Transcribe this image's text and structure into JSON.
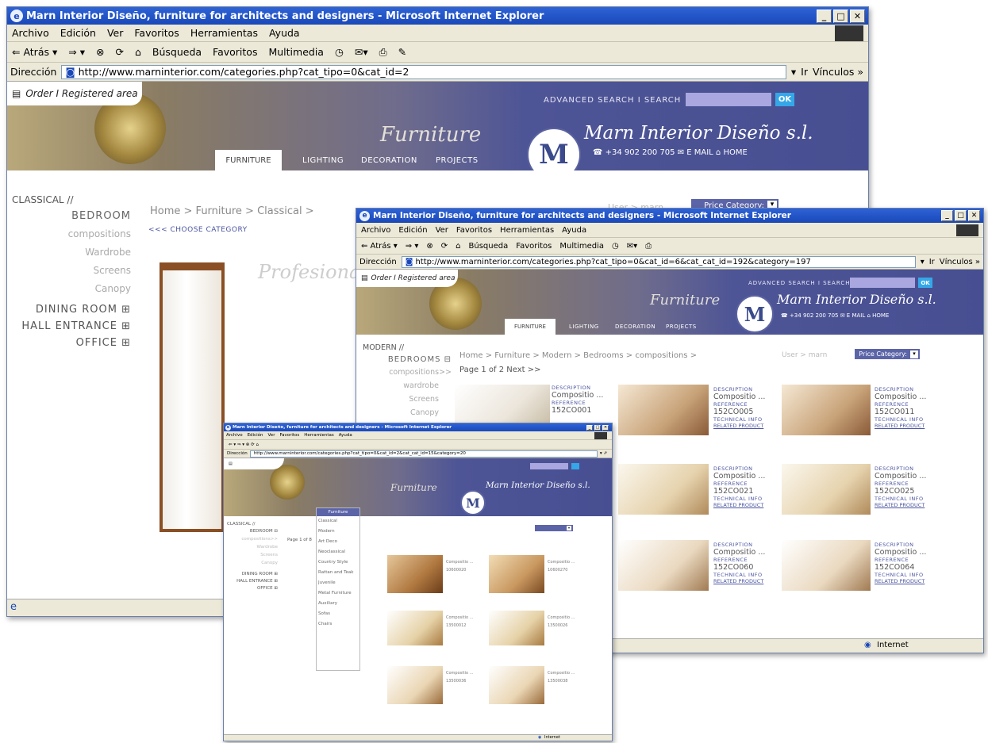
{
  "windows": {
    "back": {
      "title": "Marn Interior Diseño, furniture for architects and designers - Microsoft Internet Explorer",
      "menu": [
        "Archivo",
        "Edición",
        "Ver",
        "Favoritos",
        "Herramientas",
        "Ayuda"
      ],
      "toolbar": [
        "⇐ Atrás ▾",
        "⇒ ▾",
        "Búsqueda",
        "Favoritos",
        "Multimedia"
      ],
      "address_label": "Dirección",
      "url": "http://www.marninterior.com/categories.php?cat_tipo=0&cat_id=2",
      "go": "Ir",
      "links": "Vínculos »",
      "order": "Order I Registered area",
      "search_label": "ADVANCED SEARCH  I  SEARCH",
      "ok": "OK",
      "brand": "Marn Interior Diseño s.l.",
      "contact": "☎ +34 902 200 705   ✉ E MAIL   ⌂ HOME",
      "furniture_word": "Furniture",
      "nav": [
        "FURNITURE",
        "LIGHTING",
        "DECORATION",
        "PROJECTS"
      ],
      "logo": "M",
      "side_title": "CLASSICAL //",
      "side_items": [
        "BEDROOM",
        "compositions",
        "Wardrobe",
        "Screens",
        "Canopy"
      ],
      "side_groups": [
        "DINING ROOM ⊞",
        "HALL ENTRANCE ⊞",
        "OFFICE ⊞"
      ],
      "crumb": "Home > Furniture > Classical >",
      "choose": "<<< CHOOSE CATEGORY",
      "script_word": "Profesionale",
      "user": "User > marn",
      "price_category": "Price Category:"
    },
    "mid": {
      "title": "Marn Interior Diseño, furniture for architects and designers - Microsoft Internet Explorer",
      "menu": [
        "Archivo",
        "Edición",
        "Ver",
        "Favoritos",
        "Herramientas",
        "Ayuda"
      ],
      "toolbar": [
        "⇐ Atrás ▾",
        "⇒ ▾",
        "Búsqueda",
        "Favoritos",
        "Multimedia"
      ],
      "address_label": "Dirección",
      "url": "http://www.marninterior.com/categories.php?cat_tipo=0&cat_id=6&cat_cat_id=192&category=197",
      "go": "Ir",
      "links": "Vínculos »",
      "order": "Order I Registered area",
      "search_label": "ADVANCED SEARCH  I  SEARCH",
      "ok": "OK",
      "brand": "Marn Interior Diseño s.l.",
      "contact": "☎ +34 902 200 705   ✉ E MAIL   ⌂ HOME",
      "furniture_word": "Furniture",
      "nav": [
        "FURNITURE",
        "LIGHTING",
        "DECORATION",
        "PROJECTS"
      ],
      "logo": "M",
      "side_title": "MODERN //",
      "side_items": [
        "BEDROOMS ⊟",
        "compositions>>",
        "wardrobe",
        "Screens",
        "Canopy"
      ],
      "crumb": "Home > Furniture > Modern > Bedrooms > compositions >",
      "page": "Page 1 of 2   Next >>",
      "user": "User > marn",
      "price_category": "Price Category:",
      "labels": {
        "description": "DESCRIPTION",
        "reference": "REFERENCE",
        "technical": "TECHNICAL INFO",
        "related": "RELATED PRODUCT"
      },
      "products": [
        {
          "name": "Compositio ...",
          "ref": "152CO001"
        },
        {
          "name": "Compositio ...",
          "ref": "152CO005"
        },
        {
          "name": "Compositio ...",
          "ref": "152CO011"
        },
        {
          "name": "Compositio ...",
          "ref": "152CO021"
        },
        {
          "name": "Compositio ...",
          "ref": "152CO025"
        },
        {
          "name": "Compositio ...",
          "ref": "152CO060"
        },
        {
          "name": "Compositio ...",
          "ref": "152CO064"
        }
      ],
      "status": "Internet"
    },
    "front": {
      "title": "Marn Interior Diseño, furniture for architects and designers - Microsoft Internet Explorer",
      "menu": [
        "Archivo",
        "Edición",
        "Ver",
        "Favoritos",
        "Herramientas",
        "Ayuda"
      ],
      "address_label": "Dirección",
      "url": "http://www.marninterior.com/categories.php?cat_tipo=0&cat_id=2&cat_cat_id=15&category=20",
      "brand": "Marn Interior Diseño s.l.",
      "logo": "M",
      "furniture_word": "Furniture",
      "side_title": "CLASSICAL //",
      "side_items": [
        "BEDROOM ⊟",
        "compositions>>",
        "Wardrobe",
        "Screens",
        "Canopy"
      ],
      "side_groups": [
        "DINING ROOM ⊞",
        "HALL ENTRANCE ⊞",
        "OFFICE ⊞"
      ],
      "page": "Page 1 of 8",
      "dropdown_head": "Furniture",
      "dropdown": [
        "Classical",
        "Modern",
        "Art Deco",
        "Neoclassical",
        "Country Style",
        "Rattan and Teak",
        "Juvenile",
        "Metal Furniture",
        "Auxiliary",
        "Sofas",
        "Chairs"
      ],
      "products": [
        {
          "name": "Compositio ...",
          "ref": "10600020"
        },
        {
          "name": "Compositio ...",
          "ref": "10600270"
        },
        {
          "name": "Compositio ...",
          "ref": "13500012"
        },
        {
          "name": "Compositio ...",
          "ref": "13500026"
        },
        {
          "name": "Compositio ...",
          "ref": "13500036"
        },
        {
          "name": "Compositio ...",
          "ref": "13500038"
        }
      ],
      "status": "Internet"
    }
  }
}
